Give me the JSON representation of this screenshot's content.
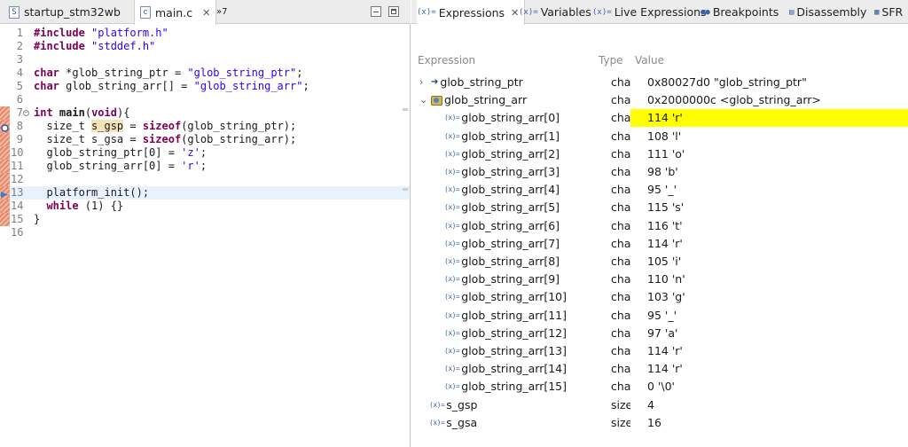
{
  "editor": {
    "tabs": [
      {
        "label": "startup_stm32wb",
        "icon": "S",
        "active": false
      },
      {
        "label": "main.c",
        "icon": "c",
        "active": true,
        "close": "✕"
      },
      {
        "label": "»7",
        "icon": "",
        "active": false
      }
    ],
    "lines": [
      {
        "n": "1",
        "html": "<span class=\"kw\">#include</span> <span class=\"str\">\"platform.h\"</span>"
      },
      {
        "n": "2",
        "html": "<span class=\"kw\">#include</span> <span class=\"str\">\"stddef.h\"</span>"
      },
      {
        "n": "3",
        "html": ""
      },
      {
        "n": "4",
        "html": "<span class=\"kw\">char</span> *glob_string_ptr = <span class=\"str\">\"glob_string_ptr\"</span>;"
      },
      {
        "n": "5",
        "html": "<span class=\"kw\">char</span> glob_string_arr[] = <span class=\"str\">\"glob_string_arr\"</span>;"
      },
      {
        "n": "6",
        "html": ""
      },
      {
        "n": "7",
        "html": "<span class=\"kw\">int</span> <b>main</b>(<span class=\"kw\">void</span>){",
        "fold": true
      },
      {
        "n": "8",
        "html": "  size_t <span class=\"hl\">s_gsp</span> = <span class=\"kw\">sizeof</span>(glob_string_ptr);"
      },
      {
        "n": "9",
        "html": "  size_t s_gsa = <span class=\"kw\">sizeof</span>(glob_string_arr);"
      },
      {
        "n": "10",
        "html": "  glob_string_ptr[0] = <span class=\"str\">'z'</span>;"
      },
      {
        "n": "11",
        "html": "  glob_string_arr[0] = <span class=\"str\">'r'</span>;"
      },
      {
        "n": "12",
        "html": ""
      },
      {
        "n": "13",
        "html": "  platform_init();",
        "current": true
      },
      {
        "n": "14",
        "html": "  <span class=\"kw\">while</span> (1) {}"
      },
      {
        "n": "15",
        "html": "}"
      },
      {
        "n": "16",
        "html": ""
      }
    ]
  },
  "views": {
    "tabs": [
      {
        "label": "Expressions",
        "icon": "(x)=",
        "active": true,
        "close": "✕"
      },
      {
        "label": "Variables",
        "icon": "(x)="
      },
      {
        "label": "Live Expressions",
        "icon": "(x)="
      },
      {
        "label": "Breakpoints",
        "icon": "●●"
      },
      {
        "label": "Disassembly",
        "icon": "▤"
      },
      {
        "label": "SFR",
        "icon": "▦"
      }
    ],
    "columns": {
      "expression": "Expression",
      "type": "Type",
      "value": "Value"
    },
    "rows": [
      {
        "indent": 0,
        "twisty": "›",
        "icon": "pointer",
        "name": "glob_string_ptr",
        "type": "cha",
        "value": "0x80027d0 \"glob_string_ptr\""
      },
      {
        "indent": 0,
        "twisty": "⌄",
        "icon": "array",
        "name": "glob_string_arr",
        "type": "cha",
        "value": "0x2000000c <glob_string_arr>"
      },
      {
        "indent": 1,
        "icon": "var",
        "name": "glob_string_arr[0]",
        "type": "cha",
        "value": "114 'r'",
        "changed": true
      },
      {
        "indent": 1,
        "icon": "var",
        "name": "glob_string_arr[1]",
        "type": "cha",
        "value": "108 'l'"
      },
      {
        "indent": 1,
        "icon": "var",
        "name": "glob_string_arr[2]",
        "type": "cha",
        "value": "111 'o'"
      },
      {
        "indent": 1,
        "icon": "var",
        "name": "glob_string_arr[3]",
        "type": "cha",
        "value": "98 'b'"
      },
      {
        "indent": 1,
        "icon": "var",
        "name": "glob_string_arr[4]",
        "type": "cha",
        "value": "95 '_'"
      },
      {
        "indent": 1,
        "icon": "var",
        "name": "glob_string_arr[5]",
        "type": "cha",
        "value": "115 's'"
      },
      {
        "indent": 1,
        "icon": "var",
        "name": "glob_string_arr[6]",
        "type": "cha",
        "value": "116 't'"
      },
      {
        "indent": 1,
        "icon": "var",
        "name": "glob_string_arr[7]",
        "type": "cha",
        "value": "114 'r'"
      },
      {
        "indent": 1,
        "icon": "var",
        "name": "glob_string_arr[8]",
        "type": "cha",
        "value": "105 'i'"
      },
      {
        "indent": 1,
        "icon": "var",
        "name": "glob_string_arr[9]",
        "type": "cha",
        "value": "110 'n'"
      },
      {
        "indent": 1,
        "icon": "var",
        "name": "glob_string_arr[10]",
        "type": "cha",
        "value": "103 'g'"
      },
      {
        "indent": 1,
        "icon": "var",
        "name": "glob_string_arr[11]",
        "type": "cha",
        "value": "95 '_'"
      },
      {
        "indent": 1,
        "icon": "var",
        "name": "glob_string_arr[12]",
        "type": "cha",
        "value": "97 'a'"
      },
      {
        "indent": 1,
        "icon": "var",
        "name": "glob_string_arr[13]",
        "type": "cha",
        "value": "114 'r'"
      },
      {
        "indent": 1,
        "icon": "var",
        "name": "glob_string_arr[14]",
        "type": "cha",
        "value": "114 'r'"
      },
      {
        "indent": 1,
        "icon": "var",
        "name": "glob_string_arr[15]",
        "type": "cha",
        "value": "0 '\\0'"
      },
      {
        "indent": 0,
        "icon": "var",
        "name": "s_gsp",
        "type": "size",
        "value": "4"
      },
      {
        "indent": 0,
        "icon": "var",
        "name": "s_gsa",
        "type": "size",
        "value": "16"
      }
    ]
  },
  "colors": {
    "changed_value": "#ffff00",
    "current_line": "#e8f2fe",
    "keyword": "#7f0055",
    "string": "#2a00ff"
  }
}
